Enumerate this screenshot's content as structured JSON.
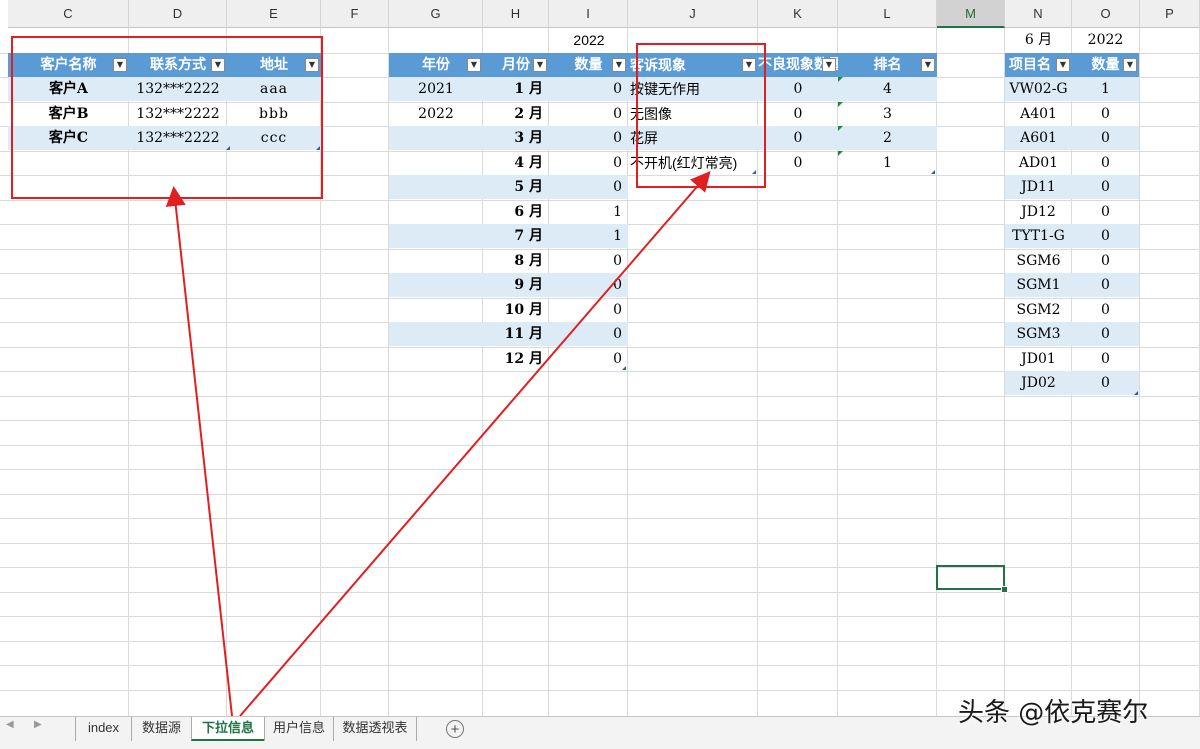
{
  "columns": [
    "C",
    "D",
    "E",
    "F",
    "G",
    "H",
    "I",
    "J",
    "K",
    "L",
    "M",
    "N",
    "O",
    "P"
  ],
  "selected_column": "M",
  "customer_table": {
    "headers": [
      "客户名称",
      "联系方式",
      "地址"
    ],
    "rows": [
      [
        "客户A",
        "132***2222",
        "aaa"
      ],
      [
        "客户B",
        "132***2222",
        "bbb"
      ],
      [
        "客户C",
        "132***2222",
        "ccc"
      ]
    ]
  },
  "year_label": "2022",
  "year_month_table": {
    "headers": [
      "年份",
      "月份",
      "数量"
    ],
    "years": [
      "2021",
      "2022"
    ],
    "months": [
      "1 月",
      "2 月",
      "3 月",
      "4 月",
      "5 月",
      "6 月",
      "7 月",
      "8 月",
      "9 月",
      "10 月",
      "11 月",
      "12 月"
    ],
    "counts": [
      "0",
      "0",
      "0",
      "0",
      "0",
      "1",
      "1",
      "0",
      "0",
      "0",
      "0",
      "0"
    ]
  },
  "complaint_table": {
    "headers": [
      "客诉现象",
      "不良现象数量",
      "排名"
    ],
    "rows": [
      [
        "按键无作用",
        "0",
        "4"
      ],
      [
        "无图像",
        "0",
        "3"
      ],
      [
        "花屏",
        "0",
        "2"
      ],
      [
        "不开机(红灯常亮)",
        "0",
        "1"
      ]
    ]
  },
  "project_table": {
    "month_label": "6 月",
    "year_label": "2022",
    "headers": [
      "项目名",
      "数量"
    ],
    "rows": [
      [
        "VW02-G",
        "1"
      ],
      [
        "A401",
        "0"
      ],
      [
        "A601",
        "0"
      ],
      [
        "AD01",
        "0"
      ],
      [
        "JD11",
        "0"
      ],
      [
        "JD12",
        "0"
      ],
      [
        "TYT1-G",
        "0"
      ],
      [
        "SGM6",
        "0"
      ],
      [
        "SGM1",
        "0"
      ],
      [
        "SGM2",
        "0"
      ],
      [
        "SGM3",
        "0"
      ],
      [
        "JD01",
        "0"
      ],
      [
        "JD02",
        "0"
      ]
    ]
  },
  "sheet_tabs": [
    "index",
    "数据源",
    "下拉信息",
    "用户信息",
    "数据透视表"
  ],
  "active_tab": "下拉信息",
  "watermark": "头条 @依克赛尔",
  "colors": {
    "table_header": "#5b9bd5",
    "table_band": "#ddebf7",
    "accent": "#217346",
    "annotation": "#e02020"
  }
}
